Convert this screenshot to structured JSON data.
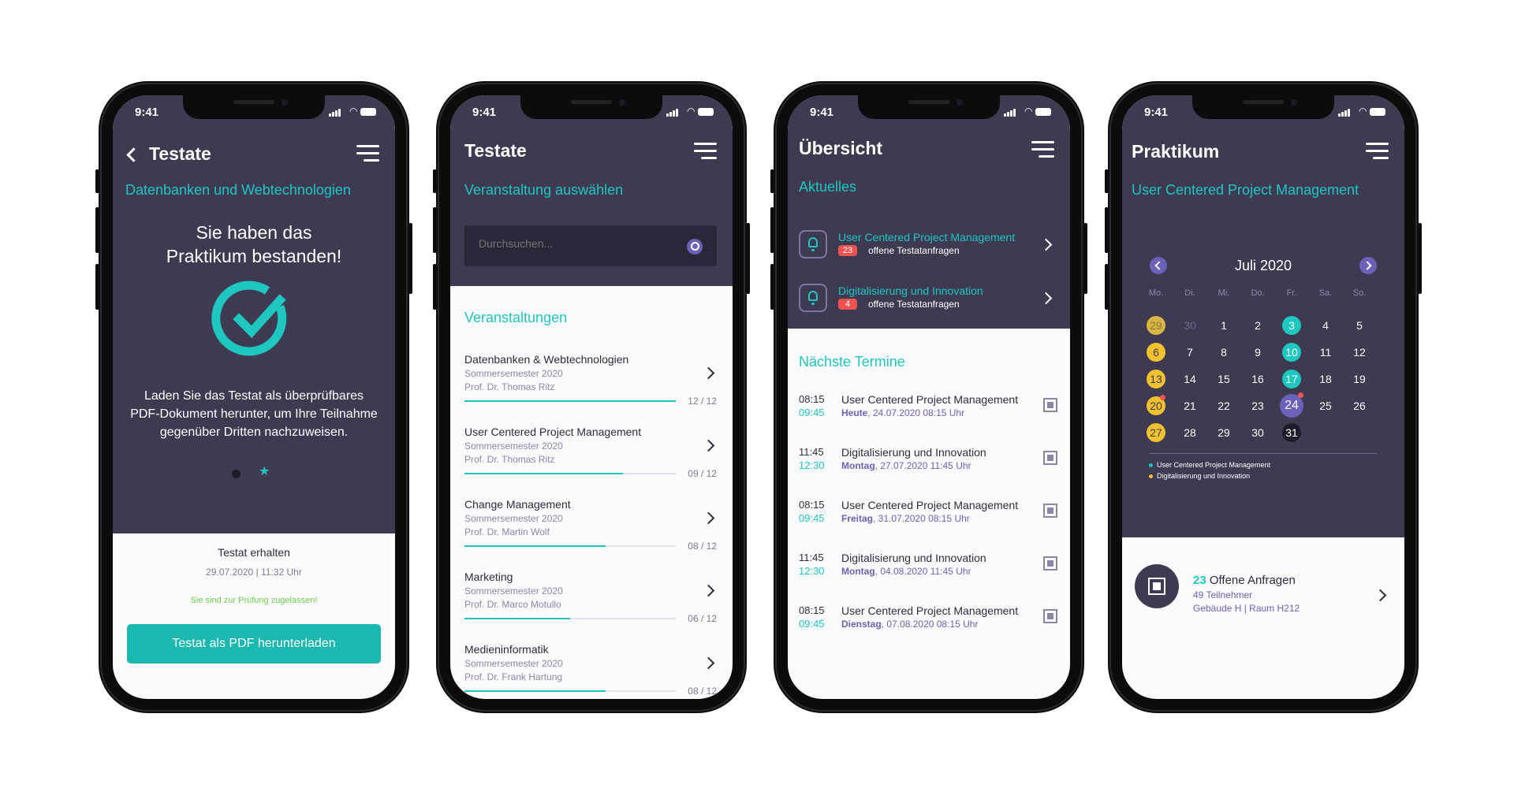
{
  "status_time": "9:41",
  "screen1": {
    "title": "Testate",
    "course": "Datenbanken und Webtechnologien",
    "headline_line1": "Sie haben das",
    "headline_line2": "Praktikum bestanden!",
    "description_line1": "Laden Sie das Testat als überprüfbares",
    "description_line2": "PDF-Dokument herunter, um Ihre Teilnahme",
    "description_line3": "gegenüber Dritten nachzuweisen.",
    "received_label": "Testat erhalten",
    "received_date": "29.07.2020 | 11:32 Uhr",
    "admitted_text": "Sie sind zur Prüfung zugelassen!",
    "download_label": "Testat als PDF herunterladen",
    "colors": {
      "teal": "#1ec7c0",
      "dark": "#3d3a52",
      "green": "#6ccf4a"
    }
  },
  "screen2": {
    "title": "Testate",
    "select_label": "Veranstaltung auswählen",
    "search_placeholder": "Durchsuchen...",
    "list_heading": "Veranstaltungen",
    "courses": [
      {
        "name": "Datenbanken & Webtechnologien",
        "semester": "Sommersemester 2020",
        "prof": "Prof. Dr. Thomas Ritz",
        "progress": "12 / 12",
        "fraction": 1.0
      },
      {
        "name": "User Centered Project Management",
        "semester": "Sommersemester 2020",
        "prof": "Prof. Dr. Thomas Ritz",
        "progress": "09 / 12",
        "fraction": 0.75
      },
      {
        "name": "Change Management",
        "semester": "Sommersemester 2020",
        "prof": "Prof. Dr. Martin Wolf",
        "progress": "08 / 12",
        "fraction": 0.6667
      },
      {
        "name": "Marketing",
        "semester": "Sommersemester 2020",
        "prof": "Prof. Dr. Marco Motullo",
        "progress": "06 / 12",
        "fraction": 0.5
      },
      {
        "name": "Medieninformatik",
        "semester": "Sommersemester 2020",
        "prof": "Prof. Dr. Frank Hartung",
        "progress": "08 / 12",
        "fraction": 0.6667
      }
    ]
  },
  "screen3": {
    "title": "Übersicht",
    "news_heading": "Aktuelles",
    "news": [
      {
        "course": "User Centered Project Management",
        "count": "23",
        "text": "offene Testatanfragen"
      },
      {
        "course": "Digitalisierung und Innovation",
        "count": "4",
        "text": "offene Testatanfragen"
      }
    ],
    "next_heading": "Nächste Termine",
    "appointments": [
      {
        "start": "08:15",
        "end": "09:45",
        "course": "User Centered Project Management",
        "day": "Heute",
        "date": ", 24.07.2020 08:15 Uhr"
      },
      {
        "start": "11:45",
        "end": "12:30",
        "course": "Digitalisierung und Innovation",
        "day": "Montag",
        "date": ", 27.07.2020 11:45 Uhr"
      },
      {
        "start": "08:15",
        "end": "09:45",
        "course": "User Centered Project Management",
        "day": "Freitag",
        "date": ", 31.07.2020 08:15 Uhr"
      },
      {
        "start": "11:45",
        "end": "12:30",
        "course": "Digitalisierung und Innovation",
        "day": "Montag",
        "date": ", 04.08.2020 11:45 Uhr"
      },
      {
        "start": "08:15",
        "end": "09:45",
        "course": "User Centered Project Management",
        "day": "Dienstag",
        "date": ", 07.08.2020 08:15 Uhr"
      }
    ]
  },
  "screen4": {
    "title": "Praktikum",
    "course": "User Centered Project Management",
    "month": "Juli 2020",
    "weekdays": [
      "Mo.",
      "Di.",
      "Mi.",
      "Do.",
      "Fr.",
      "Sa.",
      "So."
    ],
    "days": [
      {
        "t": "29",
        "s": "yellow-muted"
      },
      {
        "t": "30",
        "s": "muted"
      },
      {
        "t": "1",
        "s": ""
      },
      {
        "t": "2",
        "s": ""
      },
      {
        "t": "3",
        "s": "teal"
      },
      {
        "t": "4",
        "s": ""
      },
      {
        "t": "5",
        "s": ""
      },
      {
        "t": "6",
        "s": "yellow"
      },
      {
        "t": "7",
        "s": ""
      },
      {
        "t": "8",
        "s": ""
      },
      {
        "t": "9",
        "s": ""
      },
      {
        "t": "10",
        "s": "teal"
      },
      {
        "t": "11",
        "s": ""
      },
      {
        "t": "12",
        "s": ""
      },
      {
        "t": "13",
        "s": "yellow"
      },
      {
        "t": "14",
        "s": ""
      },
      {
        "t": "15",
        "s": ""
      },
      {
        "t": "16",
        "s": ""
      },
      {
        "t": "17",
        "s": "teal"
      },
      {
        "t": "18",
        "s": ""
      },
      {
        "t": "19",
        "s": ""
      },
      {
        "t": "20",
        "s": "yellow-dot"
      },
      {
        "t": "21",
        "s": ""
      },
      {
        "t": "22",
        "s": ""
      },
      {
        "t": "23",
        "s": ""
      },
      {
        "t": "24",
        "s": "today-dot"
      },
      {
        "t": "25",
        "s": ""
      },
      {
        "t": "26",
        "s": ""
      },
      {
        "t": "27",
        "s": "yellow"
      },
      {
        "t": "28",
        "s": ""
      },
      {
        "t": "29",
        "s": ""
      },
      {
        "t": "30",
        "s": ""
      },
      {
        "t": "31",
        "s": "black"
      },
      {
        "t": "",
        "s": ""
      },
      {
        "t": "",
        "s": ""
      }
    ],
    "legend": [
      {
        "label": "User Centered Project Management",
        "color": "#1ec7c0"
      },
      {
        "label": "Digitalisierung und Innovation",
        "color": "#f2c12e"
      }
    ],
    "requests_count": "23",
    "requests_label": " Offene Anfragen",
    "participants": "49 Teilnehmer",
    "room": "Gebäude H | Raum H212"
  }
}
